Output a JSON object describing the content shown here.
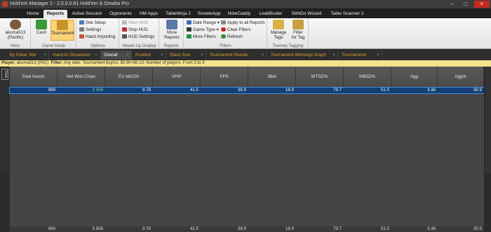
{
  "window": {
    "title": "Hold'em Manager 2 - 2.0.0.0.81 Hold'em & Omaha Pro"
  },
  "menu": {
    "tabs": [
      "Home",
      "Reports",
      "Active Session",
      "Opponents",
      "HM Apps",
      "TableNinja 2",
      "SnowieApp",
      "NoteCaddy",
      "LeakBuster",
      "SitNGo Wizard",
      "Table Scanner 2"
    ],
    "active": "Reports"
  },
  "ribbon": {
    "hero": {
      "name": "akuma513",
      "site": "(Pacific)",
      "group": "Hero"
    },
    "game_mode": {
      "cash": "Cash",
      "tournament": "Tournament",
      "group": "Game Mode"
    },
    "options": {
      "site_setup": "Site Setup",
      "settings": "Settings",
      "hand_importing": "Hand Importing",
      "group": "Options"
    },
    "hud": {
      "start": "Start HUD",
      "stop": "Stop HUD",
      "settings": "HUD Settings",
      "group": "Heads-Up Display"
    },
    "reports": {
      "more_reports_l1": "More",
      "more_reports_l2": "Reports",
      "group": "Reports"
    },
    "filters": {
      "date_range": "Date Range",
      "game_type": "Game Type",
      "more_filters": "More Filters",
      "apply_all": "Apply to all Reports",
      "clear": "Clear Filters",
      "refresh": "Refresh",
      "group": "Filters"
    },
    "tourney_tagging": {
      "manage_l1": "Manage",
      "manage_l2": "Tags",
      "filter_l1": "Filter",
      "filter_l2": "for Tag",
      "group": "Tourney Tagging"
    }
  },
  "view_tabs": [
    "By Poker Site",
    "Hand At Showdown",
    "Overall",
    "Position",
    "Stack Size",
    "Tournament Results",
    "Tournament Winnings Graph",
    "Tournaments"
  ],
  "active_view_tab": "Overall",
  "filterbar": {
    "player_label": "Player:",
    "player": "akuma513 (PAC)",
    "filter_label": "Filter:",
    "filter": "Any date; Tournament buyins: $0.90+$0.10; Number of players: From 3 to 3"
  },
  "side_label": "Stats",
  "table": {
    "columns": [
      "Total Hands",
      "Net Won Chips",
      "EV bb/100",
      "VPIP",
      "PFR",
      "3Bet",
      "WTSD%",
      "W$SD%",
      "Agg",
      "Agg%"
    ],
    "selected_row": [
      "969",
      "3 506",
      "9.78",
      "41.5",
      "39.9",
      "18.9",
      "79.7",
      "51.5",
      "3.38",
      "30.9"
    ],
    "total_row": [
      "969",
      "3 506",
      "9.78",
      "41.5",
      "39.9",
      "18.9",
      "79.7",
      "51.5",
      "3.38",
      "30.9"
    ]
  }
}
